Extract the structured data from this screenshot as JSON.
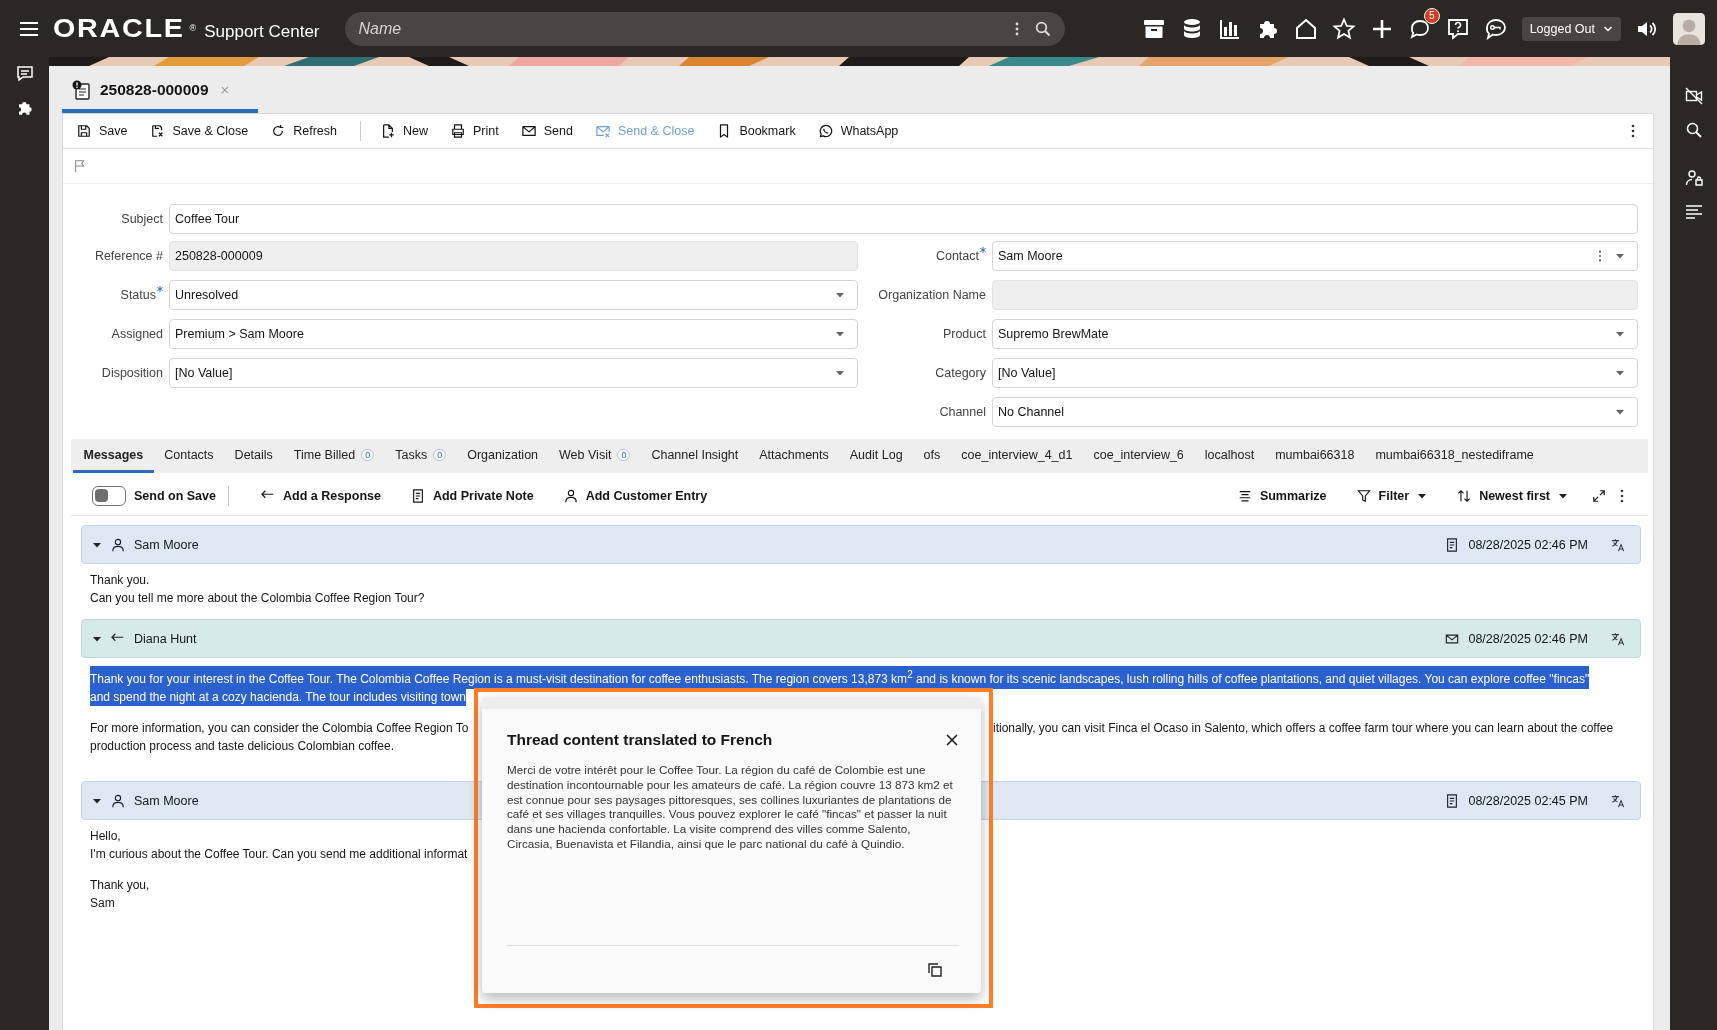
{
  "top_bar": {
    "logo": "ORACLE",
    "logo_mark": "®",
    "product": "Support Center",
    "search": {
      "placeholder": "Name"
    },
    "notification_count": "5",
    "status_select": "Logged Out"
  },
  "record_tab": {
    "title": "250828-000009",
    "close": "×",
    "selected": true
  },
  "toolbar": [
    {
      "label": "Save",
      "disabled": false
    },
    {
      "label": "Save & Close",
      "disabled": false
    },
    {
      "label": "Refresh",
      "disabled": false
    },
    {
      "label": "New",
      "disabled": false
    },
    {
      "label": "Print",
      "disabled": false
    },
    {
      "label": "Send",
      "disabled": false
    },
    {
      "label": "Send & Close",
      "disabled": true
    },
    {
      "label": "Bookmark",
      "disabled": false
    },
    {
      "label": "WhatsApp",
      "disabled": false
    }
  ],
  "form": {
    "subject": {
      "label": "Subject",
      "value": "Coffee Tour"
    },
    "left": [
      {
        "label": "Reference #",
        "value": "250828-000009",
        "kind": "readonly",
        "required": false
      },
      {
        "label": "Status",
        "value": "Unresolved",
        "kind": "select",
        "required": true
      },
      {
        "label": "Assigned",
        "value": "Premium > Sam Moore",
        "kind": "select",
        "required": false
      },
      {
        "label": "Disposition",
        "value": "[No Value]",
        "kind": "select",
        "required": false
      }
    ],
    "right": [
      {
        "label": "Contact",
        "value": "Sam Moore",
        "kind": "lookup",
        "required": true
      },
      {
        "label": "Organization Name",
        "kind": "readonly",
        "required": false
      },
      {
        "label": "Product",
        "value": "Supremo BrewMate",
        "kind": "select",
        "required": false
      },
      {
        "label": "Category",
        "value": "[No Value]",
        "kind": "select",
        "required": false
      },
      {
        "label": "Channel",
        "value": "No Channel",
        "kind": "select",
        "required": false
      }
    ]
  },
  "tabs": [
    {
      "label": "Messages",
      "selected": true
    },
    {
      "label": "Contacts",
      "selected": false
    },
    {
      "label": "Details",
      "selected": false
    },
    {
      "label": "Time Billed",
      "count": "0",
      "selected": false
    },
    {
      "label": "Tasks",
      "count": "0",
      "selected": false
    },
    {
      "label": "Organization",
      "selected": false
    },
    {
      "label": "Web Visit",
      "count": "0",
      "selected": false
    },
    {
      "label": "Channel Insight",
      "selected": false
    },
    {
      "label": "Attachments",
      "selected": false
    },
    {
      "label": "Audit Log",
      "selected": false
    },
    {
      "label": "ofs",
      "selected": false
    },
    {
      "label": "coe_interview_4_d1",
      "selected": false
    },
    {
      "label": "coe_interview_6",
      "selected": false
    },
    {
      "label": "localhost",
      "selected": false
    },
    {
      "label": "mumbai66318",
      "selected": false
    },
    {
      "label": "mumbai66318_nestediframe",
      "selected": false
    }
  ],
  "actions": {
    "send_on_save": {
      "label": "Send on Save",
      "on": false
    },
    "left": [
      "Add a Response",
      "Add Private Note",
      "Add Customer Entry"
    ],
    "summarize": "Summarize",
    "filter": "Filter",
    "sort": "Newest first"
  },
  "messages": [
    {
      "kind": "customer",
      "author": "Sam Moore",
      "date": "08/28/2025 02:46 PM",
      "expanded": true,
      "paragraphs": [
        [
          {
            "text": "Thank you.",
            "highlighted": false
          },
          {
            "text": "Can you tell me more about the Colombia Coffee Region Tour?",
            "highlighted": false
          }
        ]
      ]
    },
    {
      "kind": "agent",
      "author": "Diana Hunt",
      "date": "08/28/2025 02:46 PM",
      "expanded": true,
      "paragraphs": [
        [
          {
            "text": "Thank you for your interest in the Coffee Tour. The Colombia Coffee Region is a must-visit destination for coffee enthusiasts. The region covers 13,873 km$^{2}$ and is known for its scenic landscapes, lush rolling hills of coffee plantations, and quiet villages. You can explore coffee \"fincas\"",
            "highlighted": true
          },
          {
            "text": "and spend the night at a cozy hacienda. The tour includes visiting town",
            "highlighted": true
          }
        ],
        [
          {
            "text": "For more information, you can consider the Colombia Coffee Region To",
            "text_right": "itionally, you can visit Finca el Ocaso in Salento, which offers a coffee farm tour where you can learn about the coffee",
            "highlighted": false
          },
          {
            "text": "production process and taste delicious Colombian coffee.",
            "highlighted": false
          }
        ]
      ]
    },
    {
      "kind": "customer",
      "author": "Sam Moore",
      "date": "08/28/2025 02:45 PM",
      "expanded": true,
      "paragraphs": [
        [
          {
            "text": "Hello,",
            "highlighted": false
          },
          {
            "text": "I'm curious about the Coffee Tour. Can you send me additional informat",
            "highlighted": false
          }
        ],
        [
          {
            "text": "Thank you,",
            "highlighted": false
          },
          {
            "text": "Sam",
            "highlighted": false
          }
        ]
      ]
    }
  ],
  "dialog": {
    "title": "Thread content translated to French",
    "body": "Merci de votre intérêt pour le Coffee Tour. La région du café de Colombie est une destination incontournable pour les amateurs de café. La région couvre 13 873 km2 et est connue pour ses paysages pittoresques, ses collines luxuriantes de plantations de café et ses villages tranquilles. Vous pouvez explorer le café \"fincas\" et passer la nuit dans une hacienda confortable. La visite comprend des villes comme Salento, Circasia, Buenavista et Filandia, ainsi que le parc national du café à Quindio.",
    "focused": true
  }
}
